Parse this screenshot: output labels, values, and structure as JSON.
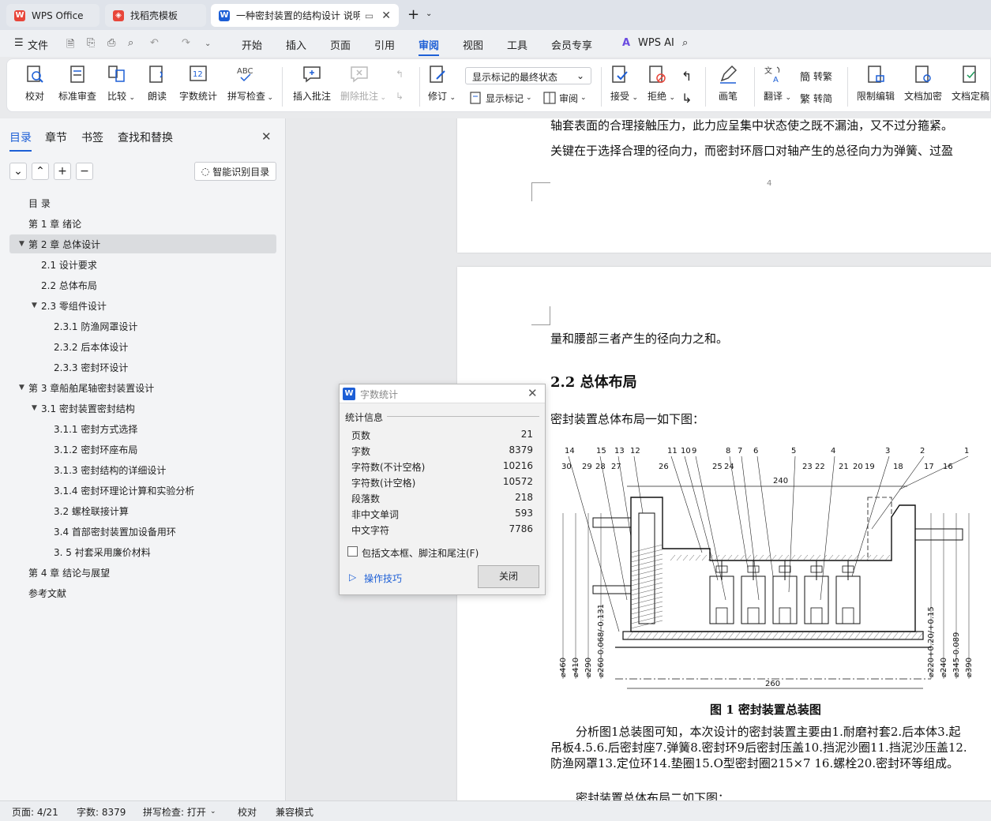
{
  "tabs": [
    {
      "label": "WPS Office",
      "icon": "wps-logo-icon"
    },
    {
      "label": "找稻壳模板",
      "icon": "docer-icon"
    },
    {
      "label": "一种密封装置的结构设计 说明",
      "icon": "writer-doc-icon"
    }
  ],
  "menu": {
    "file": "文件",
    "items": [
      "开始",
      "插入",
      "页面",
      "引用",
      "审阅",
      "视图",
      "工具",
      "会员专享"
    ],
    "active": "审阅",
    "wps_ai": "WPS AI"
  },
  "ribbon": {
    "proof": "校对",
    "std_review": "标准审查",
    "compare": "比较",
    "read_aloud": "朗读",
    "word_count": "字数统计",
    "spell_check": "拼写检查",
    "insert_comment": "插入批注",
    "delete_comment": "删除批注",
    "markup_state": "显示标记的最终状态",
    "revise": "修订",
    "show_markup": "显示标记",
    "review": "审阅",
    "accept": "接受",
    "reject": "拒绝",
    "pen": "画笔",
    "translate": "翻译",
    "to_trad": "转繁",
    "to_simp": "转简",
    "restrict_edit": "限制编辑",
    "doc_encrypt": "文档加密",
    "doc_final": "文档定稿"
  },
  "panel": {
    "tabs": [
      "目录",
      "章节",
      "书签",
      "查找和替换"
    ],
    "smart_toc": "智能识别目录",
    "toc": [
      {
        "text": "目 录",
        "level": 0,
        "tri": ""
      },
      {
        "text": "第 1 章  绪论",
        "level": 0,
        "tri": ""
      },
      {
        "text": "第 2 章  总体设计",
        "level": 0,
        "tri": "▼"
      },
      {
        "text": "2.1  设计要求",
        "level": 1,
        "tri": ""
      },
      {
        "text": "2.2    总体布局",
        "level": 1,
        "tri": ""
      },
      {
        "text": "2.3    零组件设计",
        "level": 1,
        "tri": "▼"
      },
      {
        "text": "2.3.1 防渔网罩设计",
        "level": 2,
        "tri": ""
      },
      {
        "text": "2.3.2 后本体设计",
        "level": 2,
        "tri": ""
      },
      {
        "text": "2.3.3 密封环设计",
        "level": 2,
        "tri": ""
      },
      {
        "text": "第 3 章船舶尾轴密封装置设计",
        "level": 0,
        "tri": "▼"
      },
      {
        "text": "3.1  密封装置密封结构",
        "level": 1,
        "tri": "▼"
      },
      {
        "text": "3.1.1 密封方式选择",
        "level": 2,
        "tri": ""
      },
      {
        "text": "3.1.2 密封环座布局",
        "level": 2,
        "tri": ""
      },
      {
        "text": "3.1.3 密封结构的详细设计",
        "level": 2,
        "tri": ""
      },
      {
        "text": "3.1.4 密封环理论计算和实验分析",
        "level": 2,
        "tri": ""
      },
      {
        "text": "3.2 螺栓联接计算",
        "level": 2,
        "tri": ""
      },
      {
        "text": "3.4 首部密封装置加设备用环",
        "level": 2,
        "tri": ""
      },
      {
        "text": "3. 5 衬套采用廉价材料",
        "level": 2,
        "tri": ""
      },
      {
        "text": "第 4 章  结论与展望",
        "level": 0,
        "tri": ""
      },
      {
        "text": "参考文献",
        "level": 0,
        "tri": ""
      }
    ]
  },
  "doc": {
    "line1": "轴套表面的合理接触压力，此力应呈集中状态使之既不漏油，又不过分箍紧。",
    "line2": "关键在于选择合理的径向力，而密封环唇口对轴产生的总径向力为弹簧、过盈",
    "page_num": "4",
    "line3": "量和腰部三者产生的径向力之和。",
    "heading": "2.2   总体布局",
    "line4": "密封装置总体布局一如下图：",
    "caption": "图 1 密封装置总装图",
    "para1": "分析图1总装图可知，本次设计的密封装置主要由1.耐磨衬套2.后本体3.起",
    "para2": "吊板4.5.6.后密封座7.弹簧8.密封环9后密封压盖10.挡泥沙圈11.挡泥沙压盖12.",
    "para3": "防渔网罩13.定位环14.垫圈15.O型密封圈215×7  16.螺栓20.密封环等组成。",
    "para4": "密封装置总体布局二如下图："
  },
  "drawing": {
    "labels_top": [
      "14",
      "15",
      "13",
      "12",
      "11",
      "10",
      "9",
      "8",
      "7",
      "6",
      "5",
      "4",
      "3",
      "2",
      "1"
    ],
    "labels_2nd": [
      "30",
      "29",
      "28",
      "27",
      "26",
      "25",
      "24",
      "23",
      "22",
      "21",
      "20",
      "19",
      "18",
      "17",
      "16"
    ],
    "dim_240": "240",
    "dim_260": "260",
    "left_dims": [
      "⌀460",
      "⌀410",
      "⌀290",
      "⌀260-0.068/-0.131"
    ],
    "right_dims": [
      "⌀220+0.20/+0.15",
      "⌀240",
      "⌀345-0.089",
      "⌀390"
    ]
  },
  "dialog": {
    "title": "字数统计",
    "section": "统计信息",
    "rows": [
      {
        "k": "页数",
        "v": "21"
      },
      {
        "k": "字数",
        "v": "8379"
      },
      {
        "k": "字符数(不计空格)",
        "v": "10216"
      },
      {
        "k": "字符数(计空格)",
        "v": "10572"
      },
      {
        "k": "段落数",
        "v": "218"
      },
      {
        "k": "非中文单词",
        "v": "593"
      },
      {
        "k": "中文字符",
        "v": "7786"
      }
    ],
    "checkbox": "包括文本框、脚注和尾注(F)",
    "tips": "操作技巧",
    "close": "关闭"
  },
  "status": {
    "page": "页面: 4/21",
    "words": "字数: 8379",
    "spell": "拼写检查: 打开",
    "proof": "校对",
    "compat": "兼容模式"
  },
  "colors": {
    "accent": "#1d5fd6",
    "wps_red": "#e8463a"
  }
}
